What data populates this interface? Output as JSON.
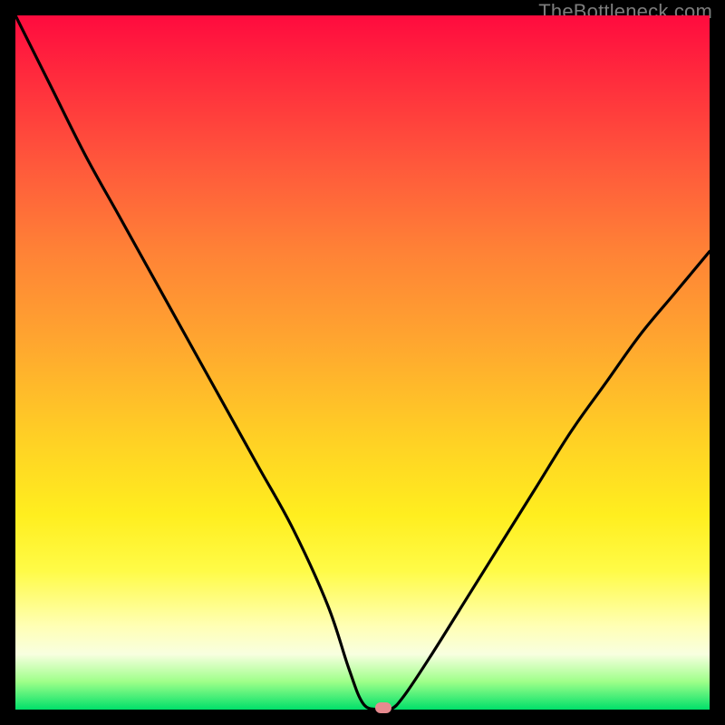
{
  "site_label": "TheBottleneck.com",
  "colors": {
    "frame_bg": "#000000",
    "curve_stroke": "#000000",
    "marker_fill": "#e68a8f",
    "label_color": "#7d7d7d",
    "gradient_stops": [
      "#ff0b3e",
      "#ff2f3d",
      "#ff5a3b",
      "#ff8236",
      "#ffa330",
      "#ffd324",
      "#ffee1f",
      "#fffb47",
      "#ffffb5",
      "#f8ffe0",
      "#9eff89",
      "#00e06a"
    ]
  },
  "chart_data": {
    "type": "line",
    "title": "",
    "xlabel": "",
    "ylabel": "",
    "xlim": [
      0,
      100
    ],
    "ylim": [
      0,
      100
    ],
    "series": [
      {
        "name": "bottleneck-curve",
        "x": [
          0,
          5,
          10,
          15,
          20,
          25,
          30,
          35,
          40,
          45,
          48,
          50,
          52,
          54,
          56,
          60,
          65,
          70,
          75,
          80,
          85,
          90,
          95,
          100
        ],
        "y": [
          100,
          90,
          80,
          71,
          62,
          53,
          44,
          35,
          26,
          15,
          6,
          1,
          0,
          0,
          2,
          8,
          16,
          24,
          32,
          40,
          47,
          54,
          60,
          66
        ]
      }
    ],
    "annotations": [
      {
        "name": "minimum-marker",
        "x": 53,
        "y": 0
      }
    ]
  }
}
